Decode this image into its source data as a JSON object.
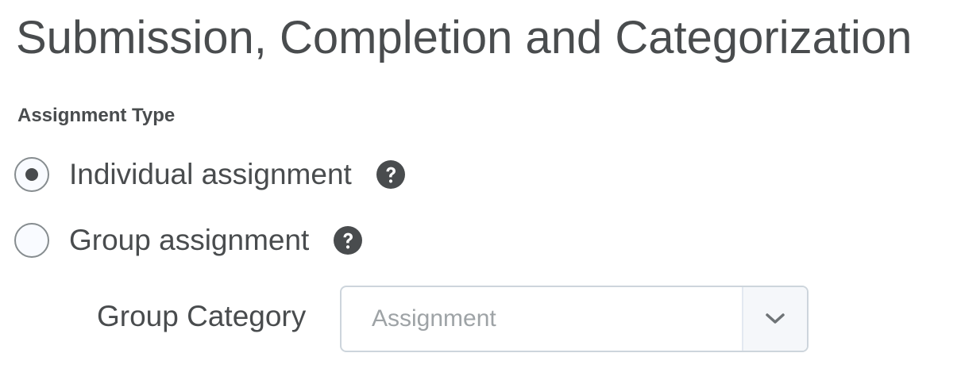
{
  "section": {
    "title": "Submission, Completion and Categorization"
  },
  "assignment_type": {
    "label": "Assignment Type",
    "options": [
      {
        "label": "Individual assignment",
        "selected": true,
        "help_icon": "question-circle-icon"
      },
      {
        "label": "Group assignment",
        "selected": false,
        "help_icon": "question-circle-icon"
      }
    ]
  },
  "group_category": {
    "label": "Group Category",
    "selected_value": "Assignment",
    "icon": "chevron-down-icon"
  }
}
